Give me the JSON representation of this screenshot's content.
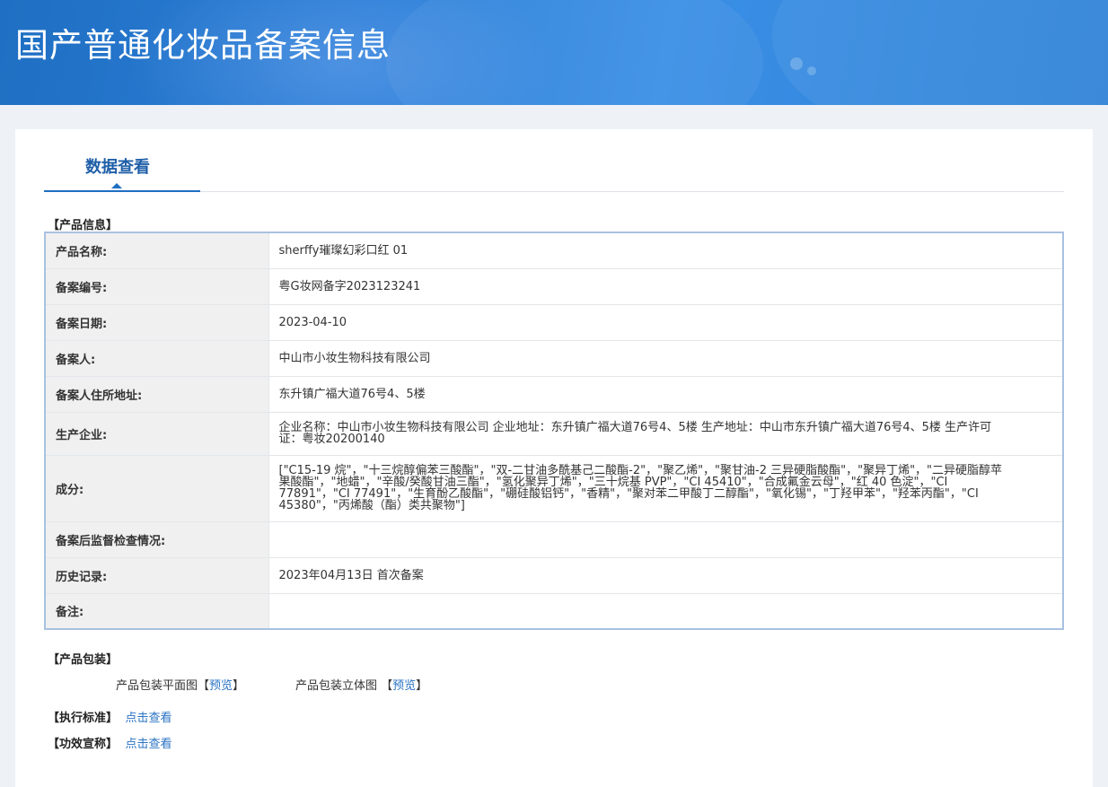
{
  "banner": {
    "title": "国产普通化妆品备案信息"
  },
  "tab": {
    "label": "数据查看"
  },
  "product_info": {
    "section_title": "【产品信息】",
    "rows": [
      {
        "key": "产品名称:",
        "value": "sherffy璀璨幻彩口红 01"
      },
      {
        "key": "备案编号:",
        "value": "粤G妆网备字2023123241"
      },
      {
        "key": "备案日期:",
        "value": "2023-04-10"
      },
      {
        "key": "备案人:",
        "value": "中山市小妆生物科技有限公司"
      },
      {
        "key": "备案人住所地址:",
        "value": "东升镇广福大道76号4、5楼"
      },
      {
        "key": "生产企业:",
        "value": "企业名称：中山市小妆生物科技有限公司 企业地址：东升镇广福大道76号4、5楼 生产地址：中山市东升镇广福大道76号4、5楼 生产许可证：粤妆20200140"
      },
      {
        "key": "成分:",
        "value": "[\"C15-19 烷\"，\"十三烷醇偏苯三酸酯\"，\"双-二甘油多酰基己二酸酯-2\"，\"聚乙烯\"，\"聚甘油-2 三异硬脂酸酯\"，\"聚异丁烯\"，\"二异硬脂醇苹果酸酯\"，\"地蜡\"，\"辛酸/癸酸甘油三酯\"，\"氢化聚异丁烯\"，\"三十烷基 PVP\"，\"CI 45410\"，\"合成氟金云母\"，\"红 40 色淀\"，\"CI 77891\"，\"CI 77491\"，\"生育酚乙酸酯\"，\"硼硅酸铝钙\"，\"香精\"，\"聚对苯二甲酸丁二醇酯\"，\"氧化锡\"，\"丁羟甲苯\"，\"羟苯丙酯\"，\"CI 45380\"，\"丙烯酸（酯）类共聚物\"]"
      },
      {
        "key": "备案后监督检查情况:",
        "value": ""
      },
      {
        "key": "历史记录:",
        "value": "2023年04月13日 首次备案"
      },
      {
        "key": "备注:",
        "value": ""
      }
    ]
  },
  "packaging": {
    "section_title": "【产品包装】",
    "flat_label": "产品包装平面图【",
    "flat_link": "预览",
    "flat_close": "】",
    "solid_label": "产品包装立体图 【",
    "solid_link": "预览",
    "solid_close": "】"
  },
  "standard": {
    "label": "【执行标准】",
    "link": "点击查看"
  },
  "efficacy": {
    "label": "【功效宣称】",
    "link": "点击查看"
  },
  "colors": {
    "banner": "#2b7fd8",
    "accent": "#1f6fc3",
    "link": "#2a73c3",
    "key_bg": "#f0f0f0"
  }
}
